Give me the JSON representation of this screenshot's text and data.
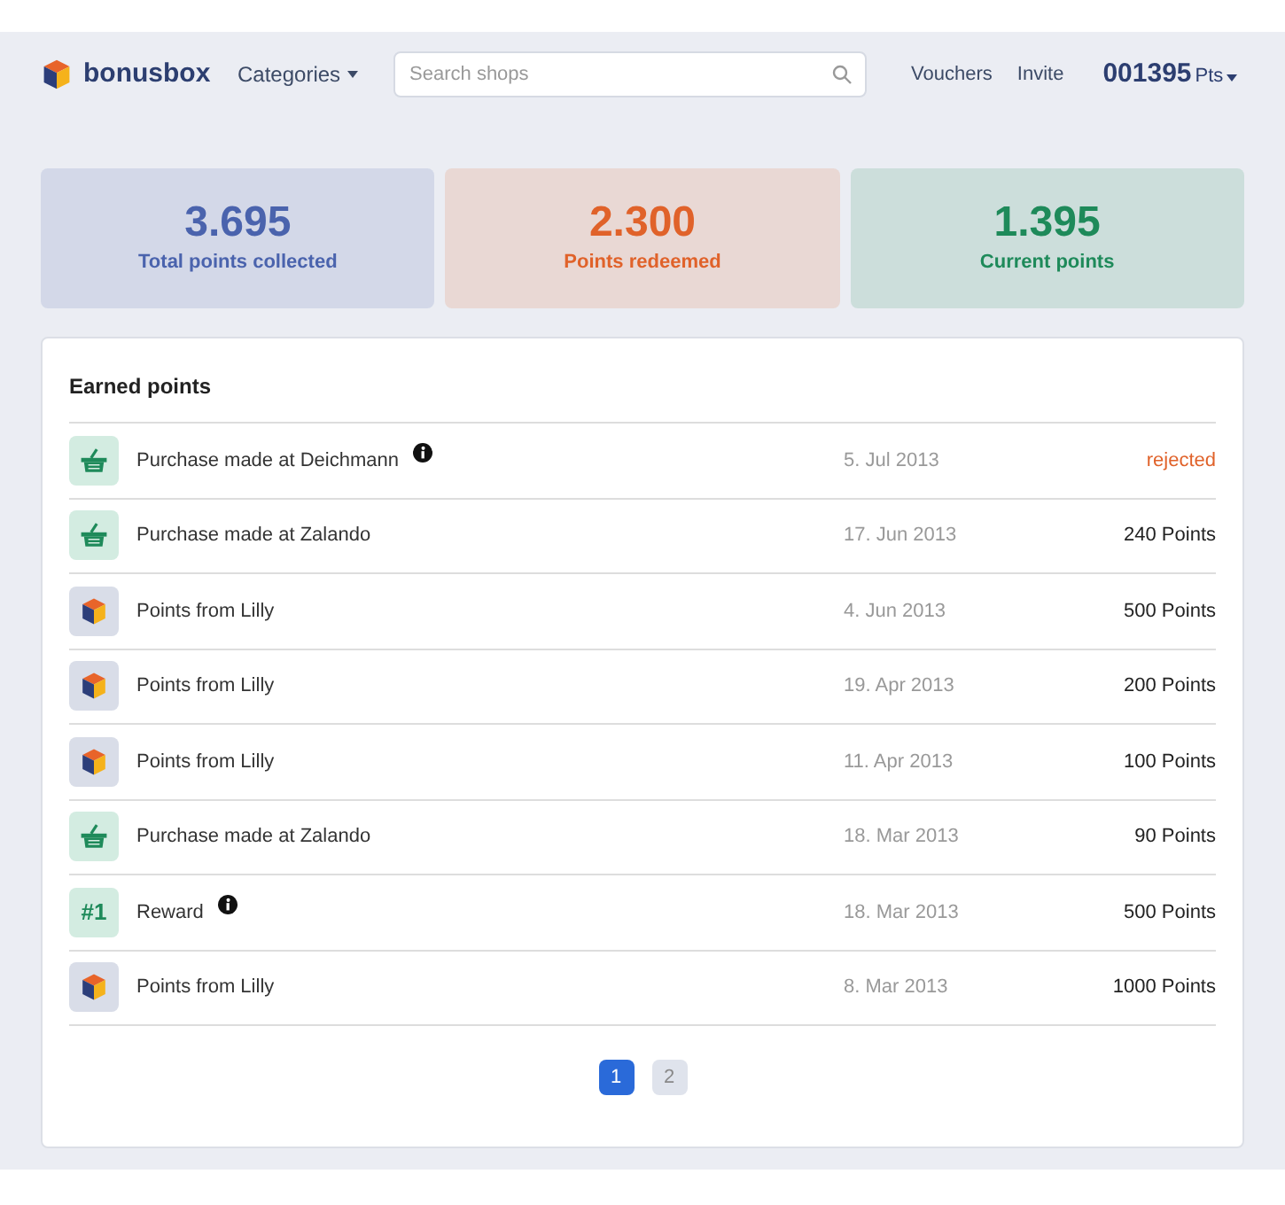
{
  "header": {
    "logo": "bonusbox",
    "nav": [
      {
        "label": "Categories",
        "dropdown": true
      },
      {
        "label": "Vouchers",
        "dropdown": false
      },
      {
        "label": "Invite",
        "dropdown": false
      }
    ],
    "search": {
      "placeholder": "Search shops"
    },
    "points": {
      "value": "001395",
      "unit": "Pts"
    }
  },
  "stats": [
    {
      "value": "3.695",
      "label": "Total points collected",
      "color": "#4a63ad"
    },
    {
      "value": "2.300",
      "label": "Points redeemed",
      "color": "#e0622a"
    },
    {
      "value": "1.395",
      "label": "Current points",
      "color": "#1e8a5a"
    }
  ],
  "earned": {
    "title": "Earned points",
    "rows": [
      {
        "kind": "basket",
        "text": "Purchase made at Deichmann",
        "info": true,
        "date": "5. Jul 2013",
        "amount": "rejected",
        "rejected": true
      },
      {
        "kind": "basket",
        "text": "Purchase made at Zalando",
        "info": false,
        "date": "17. Jun 2013",
        "amount": "240 Points",
        "rejected": false
      },
      {
        "kind": "cube",
        "text": "Points from Lilly",
        "info": false,
        "date": "4. Jun 2013",
        "amount": "500 Points",
        "rejected": false
      },
      {
        "kind": "cube",
        "text": "Points from Lilly",
        "info": false,
        "date": "19. Apr 2013",
        "amount": "200 Points",
        "rejected": false
      },
      {
        "kind": "cube",
        "text": "Points from Lilly",
        "info": false,
        "date": "11. Apr 2013",
        "amount": "100 Points",
        "rejected": false
      },
      {
        "kind": "basket",
        "text": "Purchase made at Zalando",
        "info": false,
        "date": "18. Mar 2013",
        "amount": "90 Points",
        "rejected": false
      },
      {
        "kind": "rank",
        "badge": "#1",
        "text": "Reward",
        "info": true,
        "date": "18. Mar 2013",
        "amount": "500 Points",
        "rejected": false
      },
      {
        "kind": "cube",
        "text": "Points from Lilly",
        "info": false,
        "date": "8. Mar 2013",
        "amount": "1000 Points",
        "rejected": false
      }
    ],
    "pages": [
      {
        "label": "1",
        "selected": true
      },
      {
        "label": "2",
        "selected": false
      }
    ]
  }
}
